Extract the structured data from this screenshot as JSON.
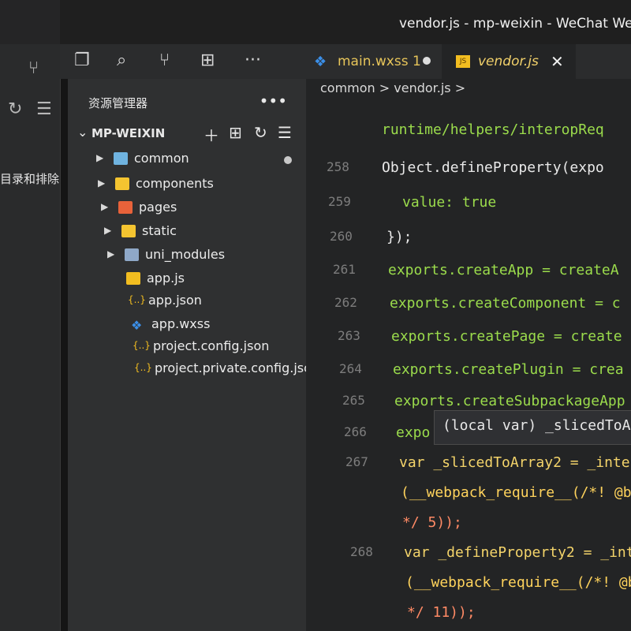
{
  "window": {
    "title": "vendor.js - mp-weixin - WeChat Web D"
  },
  "left_panel": {
    "partial_text": "目录和排除"
  },
  "activity_icons": [
    "files-icon",
    "search-icon",
    "source-control-icon",
    "extensions-icon",
    "more-icon"
  ],
  "explorer": {
    "title": "资源管理器",
    "more": "•••",
    "section_label": "MP-WEIXIN"
  },
  "tree": [
    {
      "label": "common",
      "kind": "folder",
      "expanded": false,
      "modified": true
    },
    {
      "label": "components",
      "kind": "folder",
      "expanded": false
    },
    {
      "label": "pages",
      "kind": "folder",
      "expanded": false
    },
    {
      "label": "static",
      "kind": "folder",
      "expanded": false
    },
    {
      "label": "uni_modules",
      "kind": "folder",
      "expanded": false
    },
    {
      "label": "app.js",
      "kind": "js"
    },
    {
      "label": "app.json",
      "kind": "json"
    },
    {
      "label": "app.wxss",
      "kind": "css"
    },
    {
      "label": "project.config.json",
      "kind": "json"
    },
    {
      "label": "project.private.config.json",
      "kind": "json"
    }
  ],
  "tabs": [
    {
      "label": "main.wxss 1",
      "active": false,
      "modified": true
    },
    {
      "label": "vendor.js",
      "active": true
    }
  ],
  "breadcrumb": {
    "path": "common > vendor.js >"
  },
  "hover": {
    "text": "(local var) _slicedToA"
  },
  "code": {
    "line_numbers": [
      "258",
      "259",
      "260",
      "261",
      "262",
      "263",
      "264",
      "265",
      "266",
      "267",
      "268"
    ],
    "lines": [
      "runtime/helpers/interopReq",
      "Object.defineProperty(expo",
      "value: true",
      "});",
      "exports.createApp = createA",
      "exports.createComponent = c",
      "exports.createPage = create",
      "exports.createPlugin = crea",
      "exports.createSubpackageApp",
      "expo",
      "var _slicedToArray2 = _inte",
      "(__webpack_require__(/*! @b",
      "*/ 5));",
      "var _defineProperty2 = _int",
      "(__webpack_require__(/*! @b",
      "*/ 11));"
    ]
  }
}
